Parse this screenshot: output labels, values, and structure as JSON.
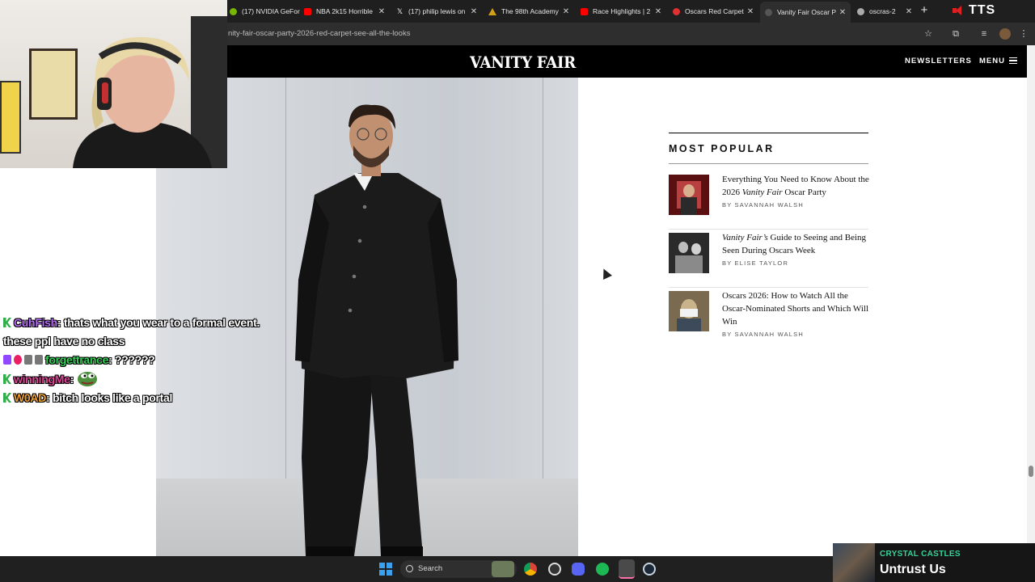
{
  "browser": {
    "tabs": [
      {
        "title": "(17) NVIDIA GeFor",
        "icon": "nvidia-icon",
        "favicon_color": "#76b900"
      },
      {
        "title": "NBA 2k15 Horrible",
        "icon": "youtube-icon",
        "favicon_color": "#ff0000"
      },
      {
        "title": "(17) philip lewis on",
        "icon": "x-icon",
        "favicon_color": "#ffffff"
      },
      {
        "title": "The 98th Academy",
        "icon": "warning-icon",
        "favicon_color": "#d4a017"
      },
      {
        "title": "Race Highlights | 2",
        "icon": "youtube-icon",
        "favicon_color": "#ff0000"
      },
      {
        "title": "Oscars Red Carpet",
        "icon": "vf-icon",
        "favicon_color": "#e03131"
      },
      {
        "title": "Vanity Fair Oscar P",
        "icon": "vf-icon",
        "favicon_color": "#555555"
      },
      {
        "title": "oscras-2",
        "icon": "link-icon",
        "favicon_color": "#aaaaaa"
      }
    ],
    "active_tab_index": 6,
    "url": "nity-fair-oscar-party-2026-red-carpet-see-all-the-looks",
    "tts_label": "TTS"
  },
  "site": {
    "logo": "VANITY FAIR",
    "nav_newsletters": "NEWSLETTERS",
    "nav_menu": "MENU"
  },
  "most_popular": {
    "heading": "MOST POPULAR",
    "items": [
      {
        "title_pre": "Everything You Need to Know About the 2026 ",
        "title_em": "Vanity Fair",
        "title_post": " Oscar Party",
        "byline": "BY SAVANNAH WALSH",
        "thumb_colors": [
          "#5a1010",
          "#b84040",
          "#2a2a2a"
        ]
      },
      {
        "title_pre": "",
        "title_em": "Vanity Fair’s",
        "title_post": " Guide to Seeing and Being Seen During Oscars Week",
        "byline": "BY ELISE TAYLOR",
        "thumb_colors": [
          "#2b2b2b",
          "#8a8a8a",
          "#d0d0d0"
        ]
      },
      {
        "title_pre": "Oscars 2026: How to Watch All the Oscar-Nominated Shorts and Which Will Win",
        "title_em": "",
        "title_post": "",
        "byline": "BY SAVANNAH WALSH",
        "thumb_colors": [
          "#7a6a50",
          "#c9b38a",
          "#3c4a5a"
        ]
      }
    ]
  },
  "chat": [
    {
      "badges": [
        "k"
      ],
      "user": "CuhFish",
      "user_color": "#b46cf0",
      "message": "thats what you wear to a formal event. these ppl have no class"
    },
    {
      "badges": [
        "tw",
        "heart",
        "gray",
        "gray"
      ],
      "user": "forgettrance",
      "user_color": "#34d058",
      "message": "??????"
    },
    {
      "badges": [
        "k"
      ],
      "user": "winningMe",
      "user_color": "#e0459a",
      "message": "",
      "emote": "pepe-emote"
    },
    {
      "badges": [
        "k"
      ],
      "user": "W0AD",
      "user_color": "#f0a030",
      "message": "bitch looks like a portal"
    }
  ],
  "taskbar": {
    "search_label": "Search",
    "icons": [
      "start-icon",
      "search-icon",
      "widgets-icon",
      "chrome-icon",
      "obs-icon",
      "discord-icon",
      "spotify-icon",
      "app-icon",
      "steam-icon"
    ]
  },
  "now_playing": {
    "artist": "CRYSTAL CASTLES",
    "track": "Untrust Us"
  }
}
